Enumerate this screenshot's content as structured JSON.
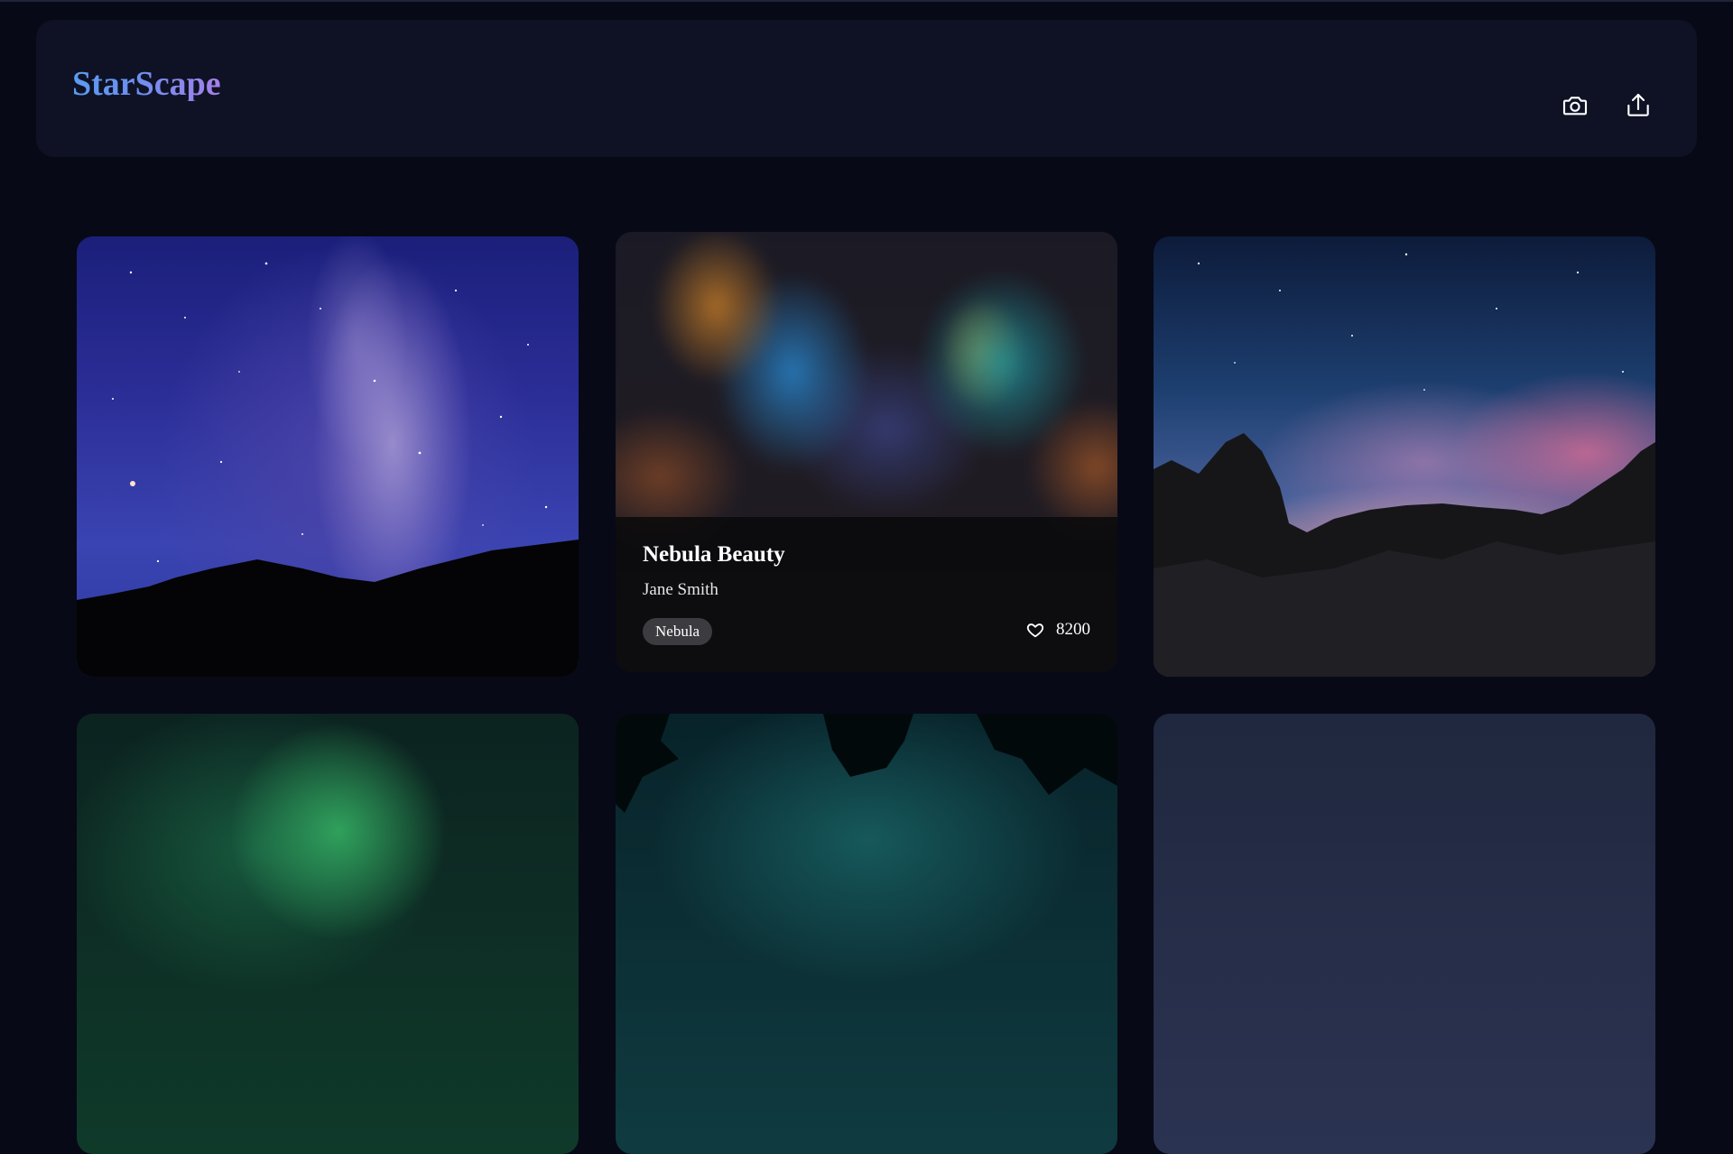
{
  "header": {
    "brand": "StarScape",
    "brand_colors": [
      "#5b9cf0",
      "#a77fe8"
    ],
    "actions": [
      {
        "name": "camera-button",
        "icon": "camera-icon"
      },
      {
        "name": "share-button",
        "icon": "share-upload-icon"
      }
    ]
  },
  "gallery": {
    "featured": {
      "title": "Nebula Beauty",
      "author": "Jane Smith",
      "tag": "Nebula",
      "likes": "8200",
      "like_icon": "heart-outline-icon"
    }
  }
}
